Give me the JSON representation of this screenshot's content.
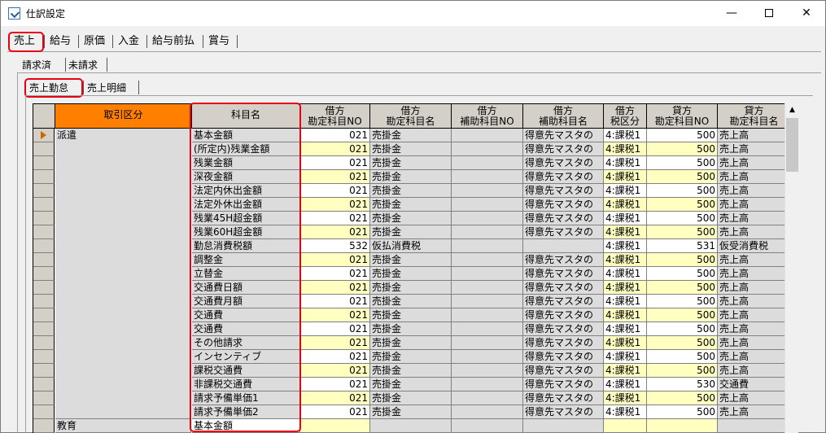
{
  "window": {
    "title": "仕訳設定"
  },
  "tabs_main": [
    "売上",
    "給与",
    "原価",
    "入金",
    "給与前払",
    "賞与"
  ],
  "tabs_sub": [
    "請求済",
    "未請求"
  ],
  "tabs_sub2": [
    "売上勤怠",
    "売上明細"
  ],
  "columns": {
    "category": "取引区分",
    "item": "科目名",
    "debit_no": [
      "借方",
      "勘定科目NO"
    ],
    "debit_name": [
      "借方",
      "勘定科目名"
    ],
    "debit_sub_no": [
      "借方",
      "補助科目NO"
    ],
    "debit_sub_name": [
      "借方",
      "補助科目名"
    ],
    "debit_tax": [
      "借方",
      "税区分"
    ],
    "credit_no": [
      "貸方",
      "勘定科目NO"
    ],
    "credit_name": [
      "貸方",
      "勘定科目名"
    ]
  },
  "category_values": [
    "派遣",
    "教育"
  ],
  "rows": [
    {
      "item": "基本金額",
      "dno": "021",
      "dname": "売掛金",
      "sub": "得意先マスタの",
      "tax": "4:課税1",
      "cno": "500",
      "cname": "売上高"
    },
    {
      "item": "(所定内)残業金額",
      "dno": "021",
      "dname": "売掛金",
      "sub": "得意先マスタの",
      "tax": "4:課税1",
      "cno": "500",
      "cname": "売上高"
    },
    {
      "item": "残業金額",
      "dno": "021",
      "dname": "売掛金",
      "sub": "得意先マスタの",
      "tax": "4:課税1",
      "cno": "500",
      "cname": "売上高"
    },
    {
      "item": "深夜金額",
      "dno": "021",
      "dname": "売掛金",
      "sub": "得意先マスタの",
      "tax": "4:課税1",
      "cno": "500",
      "cname": "売上高"
    },
    {
      "item": "法定内休出金額",
      "dno": "021",
      "dname": "売掛金",
      "sub": "得意先マスタの",
      "tax": "4:課税1",
      "cno": "500",
      "cname": "売上高"
    },
    {
      "item": "法定外休出金額",
      "dno": "021",
      "dname": "売掛金",
      "sub": "得意先マスタの",
      "tax": "4:課税1",
      "cno": "500",
      "cname": "売上高"
    },
    {
      "item": "残業45H超金額",
      "dno": "021",
      "dname": "売掛金",
      "sub": "得意先マスタの",
      "tax": "4:課税1",
      "cno": "500",
      "cname": "売上高"
    },
    {
      "item": "残業60H超金額",
      "dno": "021",
      "dname": "売掛金",
      "sub": "得意先マスタの",
      "tax": "4:課税1",
      "cno": "500",
      "cname": "売上高"
    },
    {
      "item": "勤怠消費税額",
      "dno": "532",
      "dname": "仮払消費税",
      "sub": "",
      "tax": "4:課税1",
      "cno": "531",
      "cname": "仮受消費税"
    },
    {
      "item": "調整金",
      "dno": "021",
      "dname": "売掛金",
      "sub": "得意先マスタの",
      "tax": "4:課税1",
      "cno": "500",
      "cname": "売上高"
    },
    {
      "item": "立替金",
      "dno": "021",
      "dname": "売掛金",
      "sub": "得意先マスタの",
      "tax": "4:課税1",
      "cno": "500",
      "cname": "売上高"
    },
    {
      "item": "交通費日額",
      "dno": "021",
      "dname": "売掛金",
      "sub": "得意先マスタの",
      "tax": "4:課税1",
      "cno": "500",
      "cname": "売上高"
    },
    {
      "item": "交通費月額",
      "dno": "021",
      "dname": "売掛金",
      "sub": "得意先マスタの",
      "tax": "4:課税1",
      "cno": "500",
      "cname": "売上高"
    },
    {
      "item": "交通費",
      "dno": "021",
      "dname": "売掛金",
      "sub": "得意先マスタの",
      "tax": "4:課税1",
      "cno": "500",
      "cname": "売上高"
    },
    {
      "item": "交通費",
      "dno": "021",
      "dname": "売掛金",
      "sub": "得意先マスタの",
      "tax": "4:課税1",
      "cno": "500",
      "cname": "売上高"
    },
    {
      "item": "その他請求",
      "dno": "021",
      "dname": "売掛金",
      "sub": "得意先マスタの",
      "tax": "4:課税1",
      "cno": "500",
      "cname": "売上高"
    },
    {
      "item": "インセンティブ",
      "dno": "021",
      "dname": "売掛金",
      "sub": "得意先マスタの",
      "tax": "4:課税1",
      "cno": "500",
      "cname": "売上高"
    },
    {
      "item": "課税交通費",
      "dno": "021",
      "dname": "売掛金",
      "sub": "得意先マスタの",
      "tax": "4:課税1",
      "cno": "500",
      "cname": "売上高"
    },
    {
      "item": "非課税交通費",
      "dno": "021",
      "dname": "売掛金",
      "sub": "得意先マスタの",
      "tax": "4:課税1",
      "cno": "530",
      "cname": "交通費"
    },
    {
      "item": "請求予備単価1",
      "dno": "021",
      "dname": "売掛金",
      "sub": "得意先マスタの",
      "tax": "4:課税1",
      "cno": "500",
      "cname": "売上高"
    },
    {
      "item": "請求予備単価2",
      "dno": "021",
      "dname": "売掛金",
      "sub": "得意先マスタの",
      "tax": "4:課税1",
      "cno": "500",
      "cname": "売上高"
    },
    {
      "item": "基本金額",
      "dno": "",
      "dname": "",
      "sub": "",
      "tax": "",
      "cno": "",
      "cname": ""
    }
  ],
  "scroll": {
    "up_arrow": "▲"
  }
}
